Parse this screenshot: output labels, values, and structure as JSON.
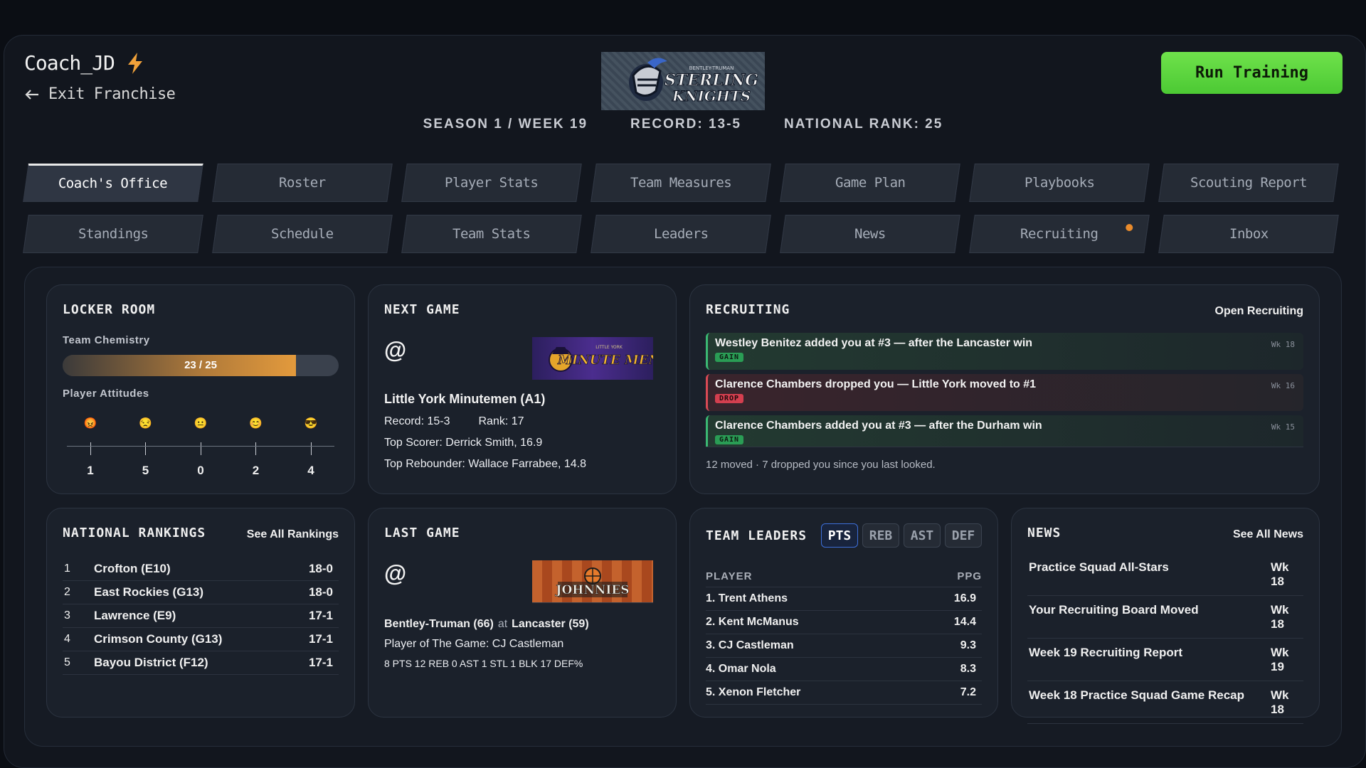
{
  "header": {
    "username": "Coach_JD",
    "exit_label": "Exit Franchise",
    "season": "SEASON 1 / WEEK 19",
    "record": "RECORD: 13-5",
    "rank": "NATIONAL RANK: 25",
    "run_training_label": "Run Training",
    "team_logo_line1": "BENTLEY-TRUMAN",
    "team_logo_line2": "STERLING",
    "team_logo_line3": "KNIGHTS"
  },
  "tabs_row1": [
    "Coach's Office",
    "Roster",
    "Player Stats",
    "Team Measures",
    "Game Plan",
    "Playbooks",
    "Scouting Report"
  ],
  "tabs_row2": [
    "Standings",
    "Schedule",
    "Team Stats",
    "Leaders",
    "News",
    "Recruiting",
    "Inbox"
  ],
  "active_tab": "Coach's Office",
  "notification_tab": "Recruiting",
  "locker_room": {
    "title": "LOCKER ROOM",
    "chemistry_label": "Team Chemistry",
    "chemistry_text": "23 / 25",
    "chemistry_value": 23,
    "chemistry_max": 25,
    "attitudes_label": "Player Attitudes",
    "attitudes": [
      {
        "icon": "angry-face-icon",
        "glyph": "😡",
        "count": "1"
      },
      {
        "icon": "unamused-face-icon",
        "glyph": "😒",
        "count": "5"
      },
      {
        "icon": "neutral-face-icon",
        "glyph": "😐",
        "count": "0"
      },
      {
        "icon": "smiling-face-icon",
        "glyph": "😊",
        "count": "2"
      },
      {
        "icon": "sunglasses-face-icon",
        "glyph": "😎",
        "count": "4"
      }
    ]
  },
  "next_game": {
    "title": "NEXT GAME",
    "at": "@",
    "opponent_logo_text": "MINUTE MEN",
    "opponent_logo_small": "LITTLE YORK",
    "opponent": "Little York Minutemen (A1)",
    "record": "Record: 15-3",
    "rank": "Rank: 17",
    "top_scorer": "Top Scorer: Derrick Smith, 16.9",
    "top_rebounder": "Top Rebounder: Wallace Farrabee, 14.8"
  },
  "recruiting": {
    "title": "RECRUITING",
    "link": "Open Recruiting",
    "items": [
      {
        "text": "Westley Benitez added you at #3 — after the Lancaster win",
        "badge": "GAIN",
        "week": "Wk 18",
        "kind": "gain"
      },
      {
        "text": "Clarence Chambers dropped you — Little York moved to #1",
        "badge": "DROP",
        "week": "Wk 16",
        "kind": "drop"
      },
      {
        "text": "Clarence Chambers added you at #3 — after the Durham win",
        "badge": "GAIN",
        "week": "Wk 15",
        "kind": "gain"
      }
    ],
    "footer": "12 moved · 7 dropped you since you last looked."
  },
  "rankings": {
    "title": "NATIONAL RANKINGS",
    "link": "See All Rankings",
    "rows": [
      {
        "n": "1",
        "team": "Crofton (E10)",
        "rec": "18-0"
      },
      {
        "n": "2",
        "team": "East Rockies (G13)",
        "rec": "18-0"
      },
      {
        "n": "3",
        "team": "Lawrence (E9)",
        "rec": "17-1"
      },
      {
        "n": "4",
        "team": "Crimson County (G13)",
        "rec": "17-1"
      },
      {
        "n": "5",
        "team": "Bayou District (F12)",
        "rec": "17-1"
      }
    ]
  },
  "last_game": {
    "title": "LAST GAME",
    "at": "@",
    "opponent_logo_text": "JOHNNIES",
    "home": "Bentley-Truman (66)",
    "at_word": "at",
    "away": "Lancaster (59)",
    "potg": "Player of The Game: CJ Castleman",
    "stats": "8 PTS 12 REB 0 AST 1 STL 1 BLK 17 DEF%"
  },
  "team_leaders": {
    "title": "TEAM LEADERS",
    "tabs": [
      "PTS",
      "REB",
      "AST",
      "DEF"
    ],
    "active": "PTS",
    "col_player": "PLAYER",
    "col_stat": "PPG",
    "rows": [
      {
        "player": "1. Trent Athens",
        "v": "16.9"
      },
      {
        "player": "2. Kent McManus",
        "v": "14.4"
      },
      {
        "player": "3. CJ Castleman",
        "v": "9.3"
      },
      {
        "player": "4. Omar Nola",
        "v": "8.3"
      },
      {
        "player": "5. Xenon Fletcher",
        "v": "7.2"
      }
    ]
  },
  "news": {
    "title": "NEWS",
    "link": "See All News",
    "rows": [
      {
        "h": "Practice Squad All-Stars",
        "w": "Wk 18"
      },
      {
        "h": "Your Recruiting Board Moved",
        "w": "Wk 18"
      },
      {
        "h": "Week 19 Recruiting Report",
        "w": "Wk 19"
      },
      {
        "h": "Week 18 Practice Squad Game Recap",
        "w": "Wk 18"
      }
    ]
  },
  "colors": {
    "accent_green": "#5bd63e",
    "gain": "#2a9d55",
    "drop": "#d43f4f",
    "notify": "#e98b2c",
    "active_tab_border": "#3d6fd9"
  }
}
